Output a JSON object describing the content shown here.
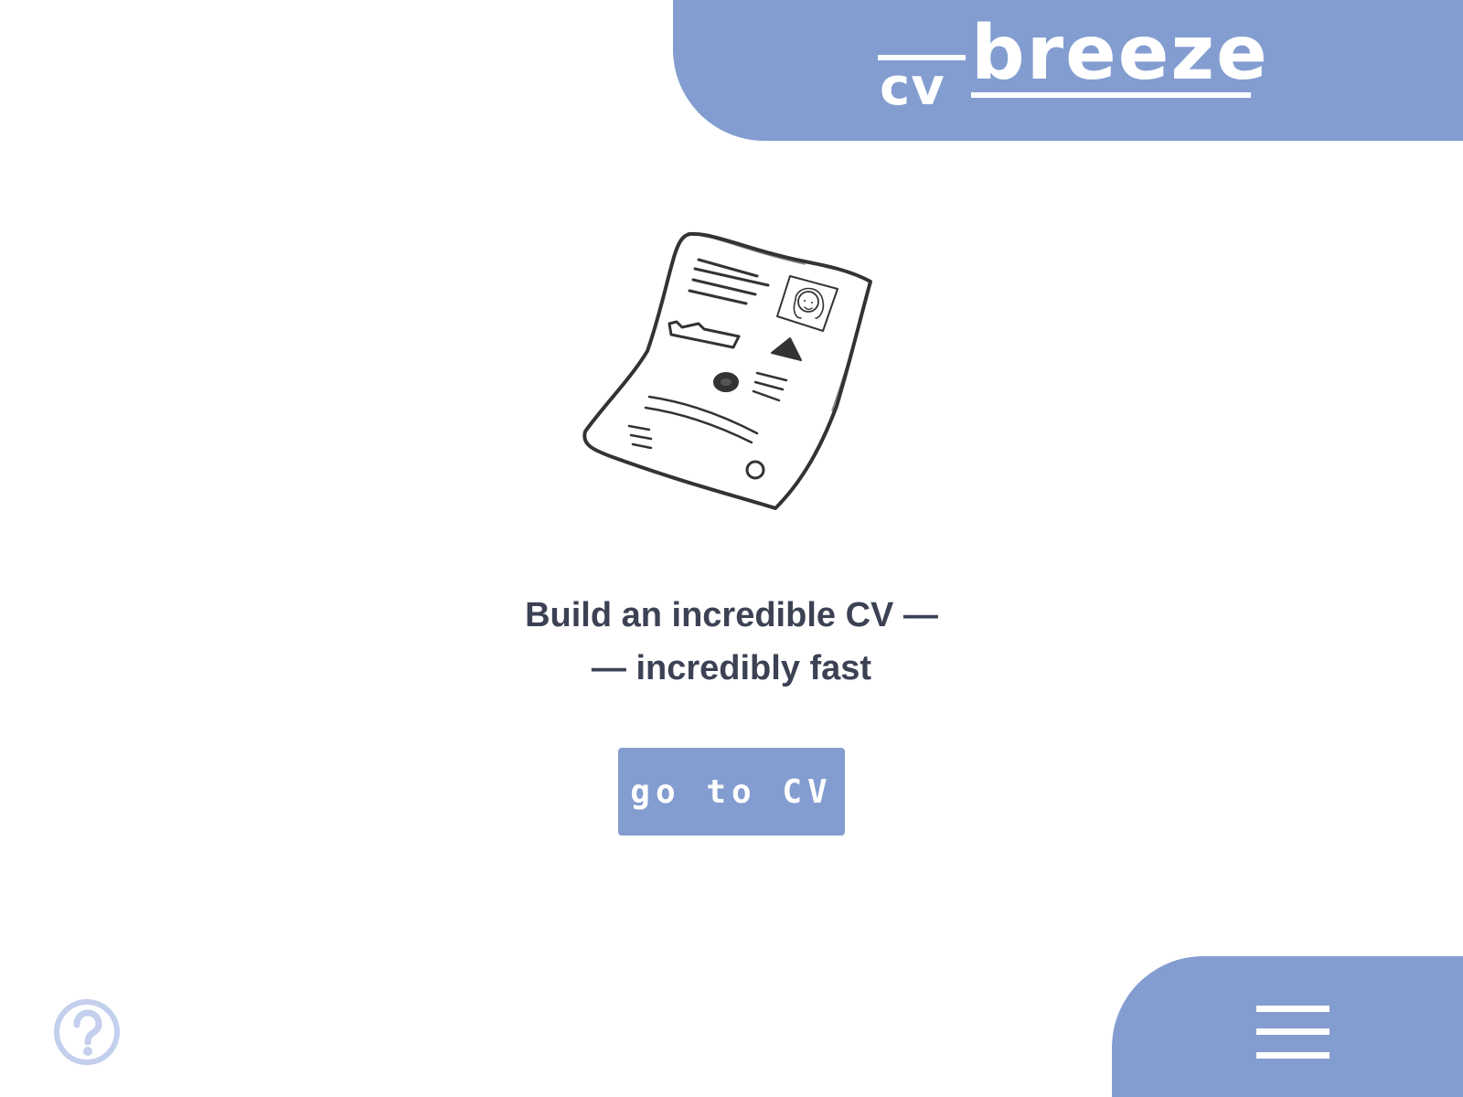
{
  "header": {
    "logo": {
      "cv": "cv",
      "breeze": "breeze"
    }
  },
  "hero": {
    "illustration_icon": "cv-document-sketch-icon",
    "tagline_line1": "Build an incredible CV —",
    "tagline_line2": "— incredibly fast",
    "cta_label": "go to CV"
  },
  "footer": {
    "help_icon": "question-circle-icon",
    "menu_icon": "hamburger-menu-icon"
  },
  "colors": {
    "accent": "#839dd0",
    "help_icon": "#c3cfec",
    "text": "#3c4254",
    "background": "#ffffff"
  }
}
